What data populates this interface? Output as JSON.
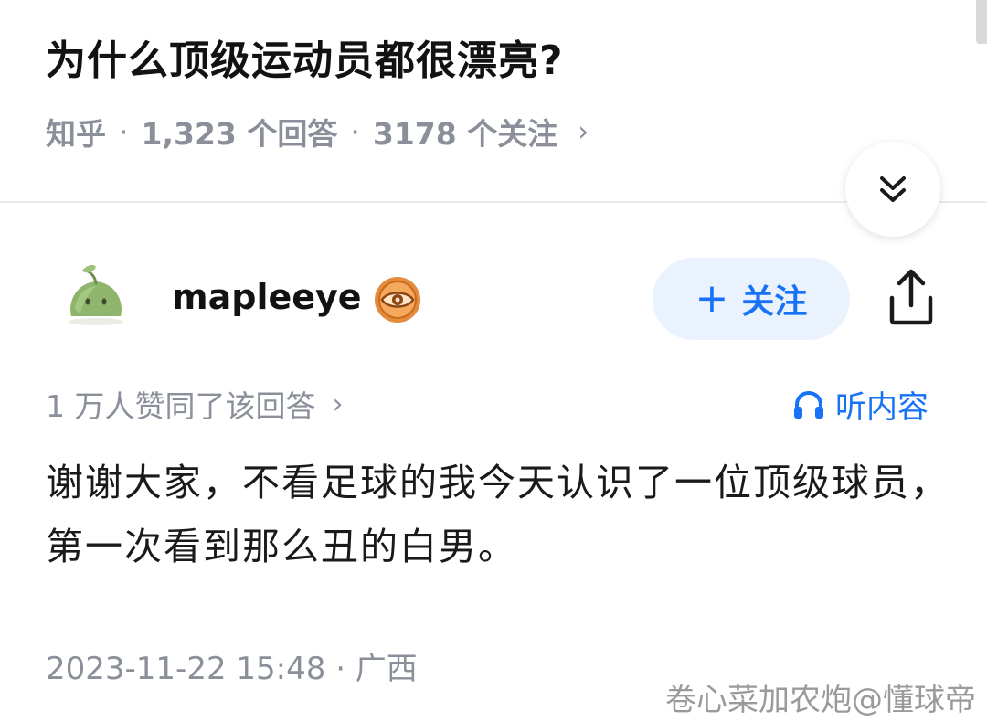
{
  "question": {
    "title": "为什么顶级运动员都很漂亮?",
    "source": "知乎",
    "answers_count": "1,323 个回答",
    "followers_count": "3178 个关注",
    "separator": "·",
    "chevron": "›"
  },
  "answer": {
    "author_name": "mapleeye",
    "follow_label": "关注",
    "follow_plus": "+",
    "votes_text": "1 万人赞同了该回答",
    "votes_chevron": "›",
    "listen_label": "听内容",
    "content": "谢谢大家，不看足球的我今天认识了一位顶级球员，第一次看到那么丑的白男。",
    "time_location": "2023-11-22 15:48 · 广西"
  },
  "watermark": "卷心菜加农炮@懂球帝",
  "icons": {
    "collapse": "double-chevron-down-icon",
    "badge": "eye-badge-icon",
    "share": "share-icon",
    "listen": "headphones-icon",
    "avatar": "slime-avatar"
  },
  "colors": {
    "accent": "#1772f6",
    "follow_bg": "#eaf2fd",
    "meta_gray": "#8a8f99",
    "badge_orange": "#e0863a"
  }
}
